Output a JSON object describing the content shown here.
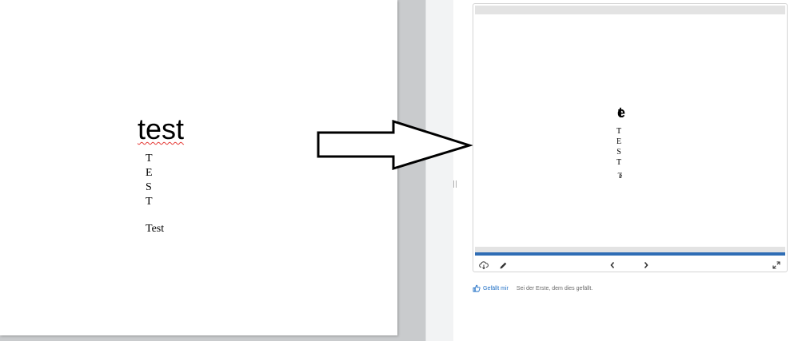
{
  "document": {
    "heading": "test",
    "letters": [
      "T",
      "E",
      "S",
      "T"
    ],
    "footer_text": "Test"
  },
  "preview": {
    "heading": "te",
    "letters": [
      "T",
      "E",
      "S",
      "T"
    ],
    "tail": "Te",
    "toolbar": {
      "download_icon": "cloud-download-icon",
      "edit_icon": "pencil-icon",
      "prev_icon": "chevron-left-icon",
      "next_icon": "chevron-right-icon",
      "fullscreen_icon": "expand-icon"
    },
    "progress_color": "#2f6db5"
  },
  "like": {
    "label": "Gefällt mir",
    "text": "Sei der Erste, dem dies gefällt."
  },
  "colors": {
    "link": "#1f6fc5",
    "workspace": "#c9cbcd",
    "spellcheck": "#e53935"
  }
}
